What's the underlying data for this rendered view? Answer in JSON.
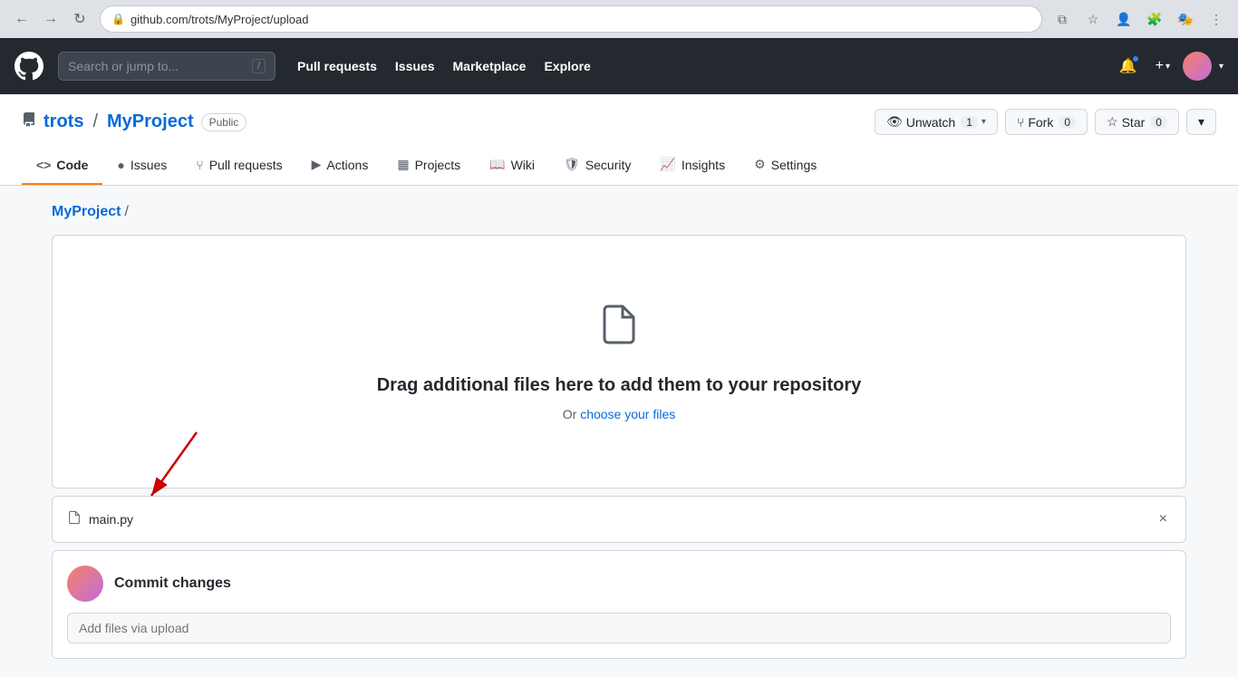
{
  "browser": {
    "url": "github.com/trots/MyProject/upload",
    "nav": {
      "back_title": "Back",
      "forward_title": "Forward",
      "reload_title": "Reload"
    }
  },
  "navbar": {
    "search_placeholder": "Search or jump to...",
    "search_slash": "/",
    "links": [
      {
        "label": "Pull requests"
      },
      {
        "label": "Issues"
      },
      {
        "label": "Marketplace"
      },
      {
        "label": "Explore"
      }
    ]
  },
  "repo": {
    "owner": "trots",
    "name": "MyProject",
    "visibility": "Public",
    "actions": {
      "watch": "Unwatch",
      "watch_count": "1",
      "fork": "Fork",
      "fork_count": "0",
      "star": "Star",
      "star_count": "0"
    },
    "tabs": [
      {
        "id": "code",
        "label": "Code",
        "active": true
      },
      {
        "id": "issues",
        "label": "Issues"
      },
      {
        "id": "pull-requests",
        "label": "Pull requests"
      },
      {
        "id": "actions",
        "label": "Actions"
      },
      {
        "id": "projects",
        "label": "Projects"
      },
      {
        "id": "wiki",
        "label": "Wiki"
      },
      {
        "id": "security",
        "label": "Security"
      },
      {
        "id": "insights",
        "label": "Insights"
      },
      {
        "id": "settings",
        "label": "Settings"
      }
    ]
  },
  "breadcrumb": {
    "repo_name": "MyProject",
    "separator": "/"
  },
  "upload": {
    "title": "Drag additional files here to add them to your repository",
    "subtitle_prefix": "Or ",
    "subtitle_link": "choose your files"
  },
  "file_item": {
    "name": "main.py",
    "remove_label": "×"
  },
  "commit": {
    "title": "Commit changes",
    "input_placeholder": "Add files via upload"
  }
}
